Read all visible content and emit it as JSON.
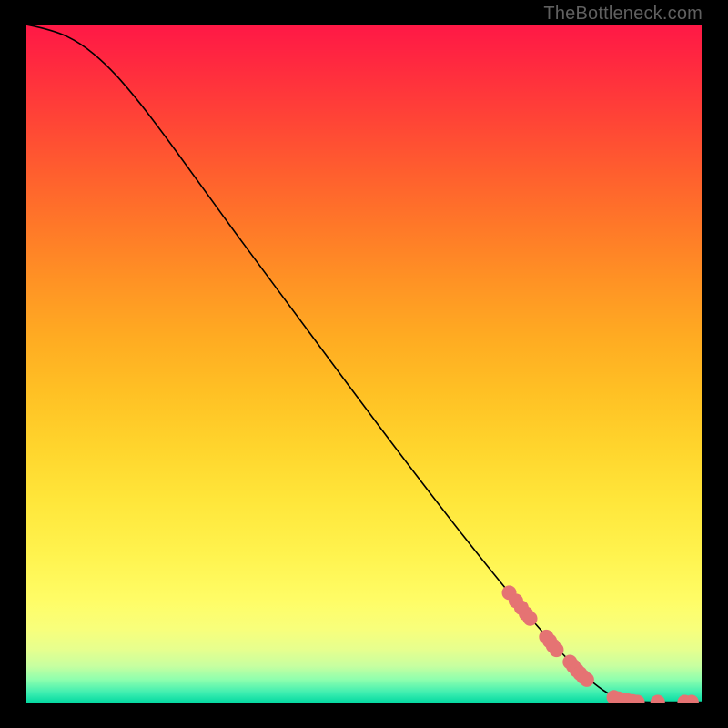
{
  "watermark": "TheBottleneck.com",
  "chart_data": {
    "type": "line",
    "title": "",
    "xlabel": "",
    "ylabel": "",
    "xlim": [
      0,
      100
    ],
    "ylim": [
      0,
      100
    ],
    "grid": false,
    "curve": [
      {
        "x": 0,
        "y": 100
      },
      {
        "x": 4,
        "y": 99.2
      },
      {
        "x": 8,
        "y": 97.3
      },
      {
        "x": 12,
        "y": 94.0
      },
      {
        "x": 16,
        "y": 89.5
      },
      {
        "x": 20,
        "y": 84.3
      },
      {
        "x": 25,
        "y": 77.5
      },
      {
        "x": 30,
        "y": 70.6
      },
      {
        "x": 35,
        "y": 63.9
      },
      {
        "x": 40,
        "y": 57.2
      },
      {
        "x": 45,
        "y": 50.5
      },
      {
        "x": 50,
        "y": 43.8
      },
      {
        "x": 55,
        "y": 37.2
      },
      {
        "x": 60,
        "y": 30.7
      },
      {
        "x": 65,
        "y": 24.3
      },
      {
        "x": 70,
        "y": 18.1
      },
      {
        "x": 75,
        "y": 12.1
      },
      {
        "x": 80,
        "y": 6.6
      },
      {
        "x": 84,
        "y": 2.9
      },
      {
        "x": 87,
        "y": 0.9
      },
      {
        "x": 90,
        "y": 0.2
      },
      {
        "x": 95,
        "y": 0.2
      },
      {
        "x": 100,
        "y": 0.2
      }
    ],
    "markers": [
      {
        "x": 71.5,
        "y": 16.3
      },
      {
        "x": 72.5,
        "y": 15.1
      },
      {
        "x": 73.3,
        "y": 14.1
      },
      {
        "x": 74.0,
        "y": 13.2
      },
      {
        "x": 74.6,
        "y": 12.5
      },
      {
        "x": 77.0,
        "y": 9.8
      },
      {
        "x": 77.5,
        "y": 9.2
      },
      {
        "x": 78.0,
        "y": 8.5
      },
      {
        "x": 78.5,
        "y": 7.9
      },
      {
        "x": 80.5,
        "y": 6.1
      },
      {
        "x": 81.0,
        "y": 5.5
      },
      {
        "x": 81.5,
        "y": 4.9
      },
      {
        "x": 82.0,
        "y": 4.4
      },
      {
        "x": 82.5,
        "y": 3.9
      },
      {
        "x": 83.0,
        "y": 3.5
      },
      {
        "x": 87.0,
        "y": 0.9
      },
      {
        "x": 87.7,
        "y": 0.7
      },
      {
        "x": 88.4,
        "y": 0.5
      },
      {
        "x": 89.1,
        "y": 0.4
      },
      {
        "x": 89.8,
        "y": 0.3
      },
      {
        "x": 90.5,
        "y": 0.2
      },
      {
        "x": 93.5,
        "y": 0.2
      },
      {
        "x": 97.5,
        "y": 0.2
      },
      {
        "x": 98.5,
        "y": 0.2
      }
    ],
    "marker_color": "#e57373",
    "curve_color": "#000000"
  }
}
